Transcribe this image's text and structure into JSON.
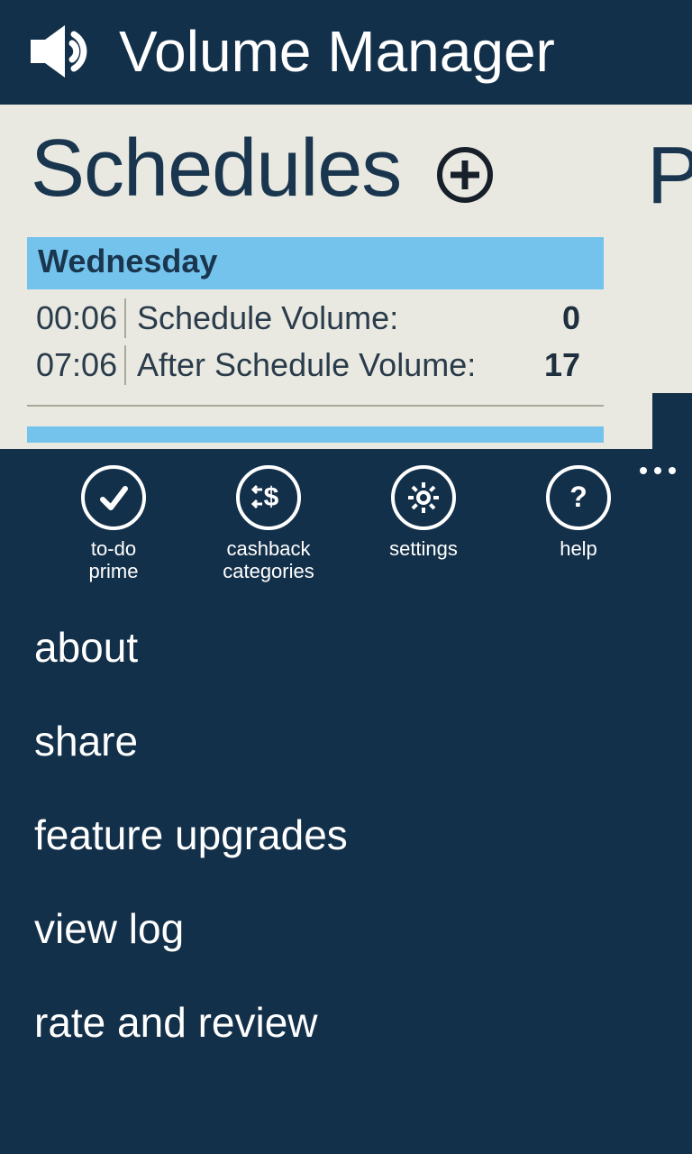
{
  "header": {
    "title": "Volume Manager"
  },
  "pivot": {
    "title": "Schedules",
    "next_peek": "P"
  },
  "schedule": {
    "day": "Wednesday",
    "rows": [
      {
        "time": "00:06",
        "label": "Schedule Volume:",
        "value": "0"
      },
      {
        "time": "07:06",
        "label": "After Schedule Volume:",
        "value": "17"
      }
    ]
  },
  "appbar": {
    "items": [
      {
        "label": "to-do prime"
      },
      {
        "label": "cashback categories"
      },
      {
        "label": "settings"
      },
      {
        "label": "help"
      }
    ]
  },
  "menu": {
    "items": [
      "about",
      "share",
      "feature upgrades",
      "view log",
      "rate and review"
    ]
  }
}
